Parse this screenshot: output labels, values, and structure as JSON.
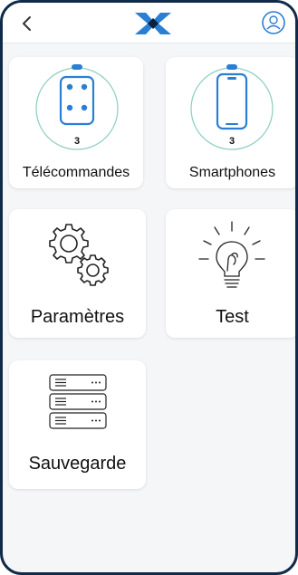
{
  "header": {
    "back_icon": "chevron-left-icon",
    "logo_icon": "brand-logo-icon",
    "profile_icon": "user-profile-icon"
  },
  "cards": {
    "remotes": {
      "label": "Télécommandes",
      "count": "3",
      "icon": "remote-icon"
    },
    "smartphones": {
      "label": "Smartphones",
      "count": "3",
      "icon": "smartphone-icon"
    },
    "settings": {
      "label": "Paramètres",
      "icon": "gears-icon"
    },
    "test": {
      "label": "Test",
      "icon": "lightbulb-icon"
    },
    "backup": {
      "label": "Sauvegarde",
      "icon": "server-icon"
    }
  },
  "colors": {
    "accent": "#2a7fd4",
    "ring": "#8fd0c4",
    "frame": "#0f2a4a",
    "logo_dark": "#0d2238"
  }
}
